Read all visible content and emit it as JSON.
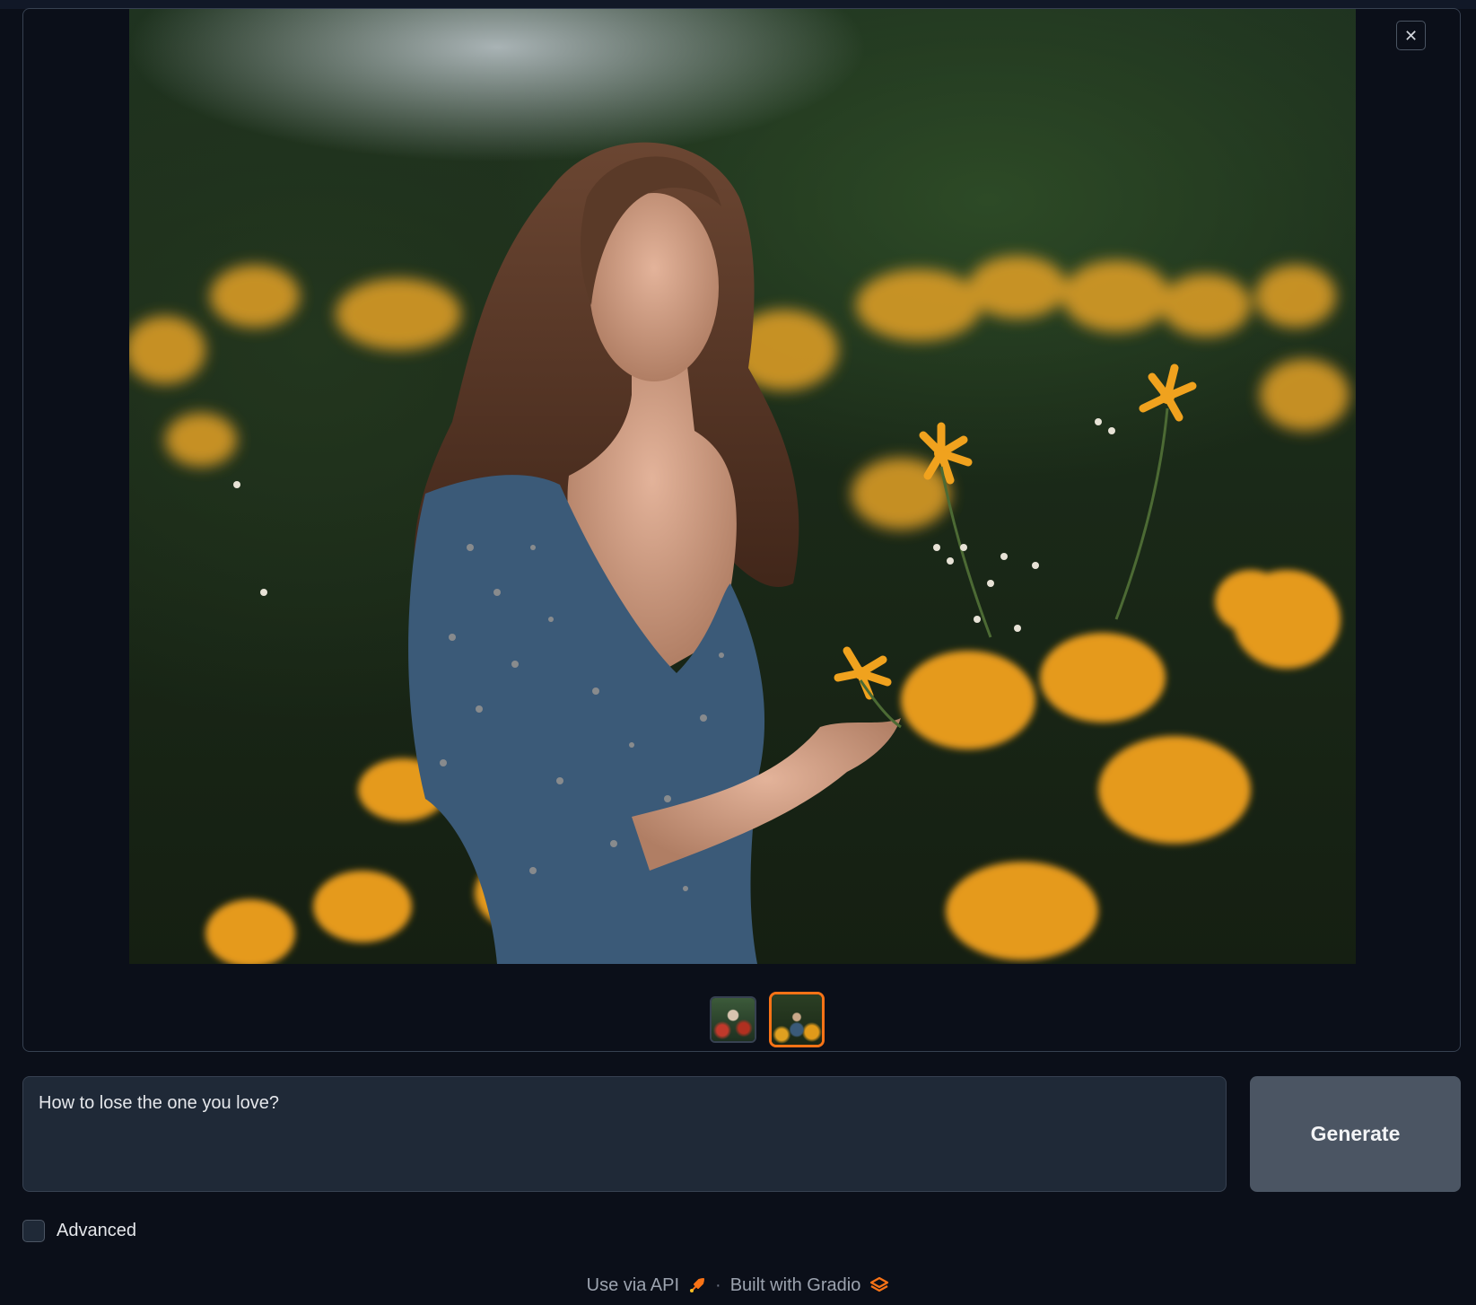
{
  "gallery": {
    "close_icon_glyph": "✕",
    "preview_alt": "woman in blue floral dress among yellow flowers",
    "thumbnails": [
      {
        "selected": false
      },
      {
        "selected": true
      }
    ],
    "accent_color": "#f97316"
  },
  "prompt": {
    "value": "How to lose the one you love?"
  },
  "generate_button": {
    "label": "Generate"
  },
  "advanced": {
    "label": "Advanced",
    "checked": false
  },
  "footer": {
    "api_label": "Use via API",
    "separator": "·",
    "built_label": "Built with Gradio"
  }
}
